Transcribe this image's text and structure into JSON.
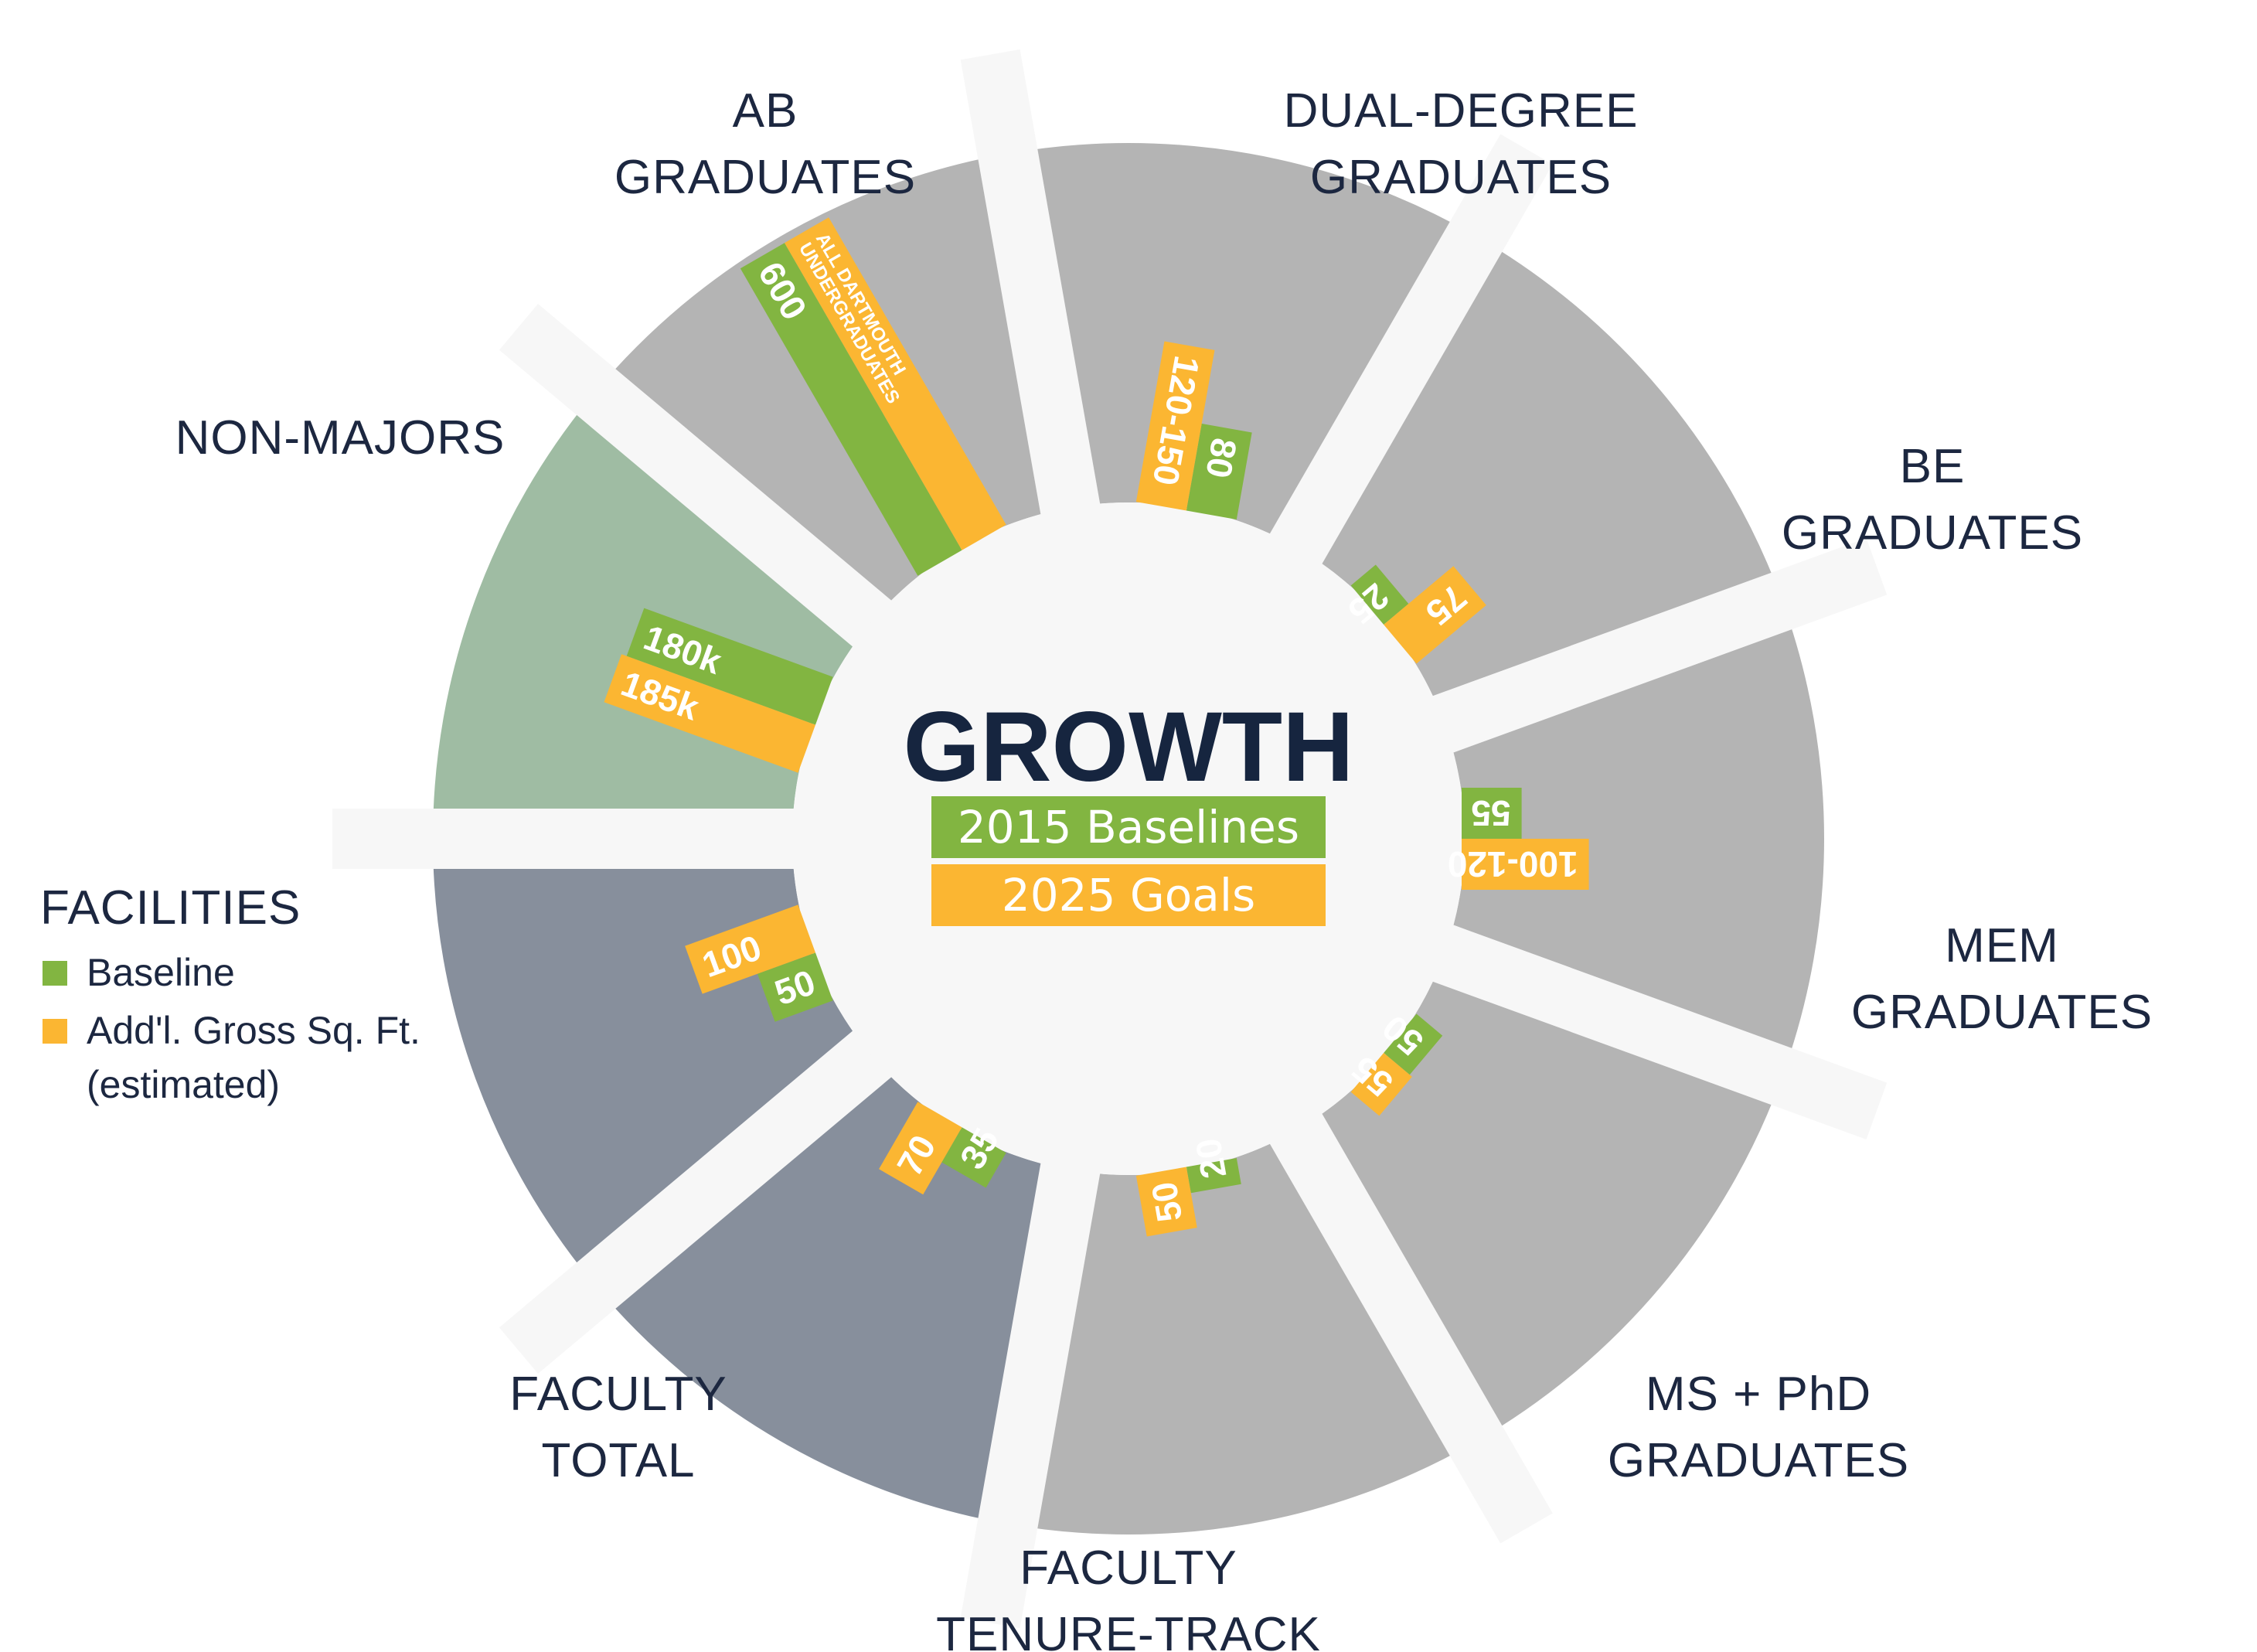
{
  "colors": {
    "baseline": "#82b541",
    "goal": "#fbb632",
    "sector_gray": "#b4b4b4",
    "sector_green": "#9fbca3",
    "sector_dark": "#878f9c",
    "gap": "#f7f7f7",
    "center": "#f7f7f7",
    "text": "#1c2740"
  },
  "center": {
    "title": "GROWTH",
    "key_baseline": "2015 Baselines",
    "key_goal": "2025 Goals"
  },
  "legend": {
    "heading": "FACILITIES",
    "baseline_label": "Baseline",
    "goal_label_line1": "Add'l. Gross Sq. Ft.",
    "goal_label_line2": "(estimated)"
  },
  "chart_data": {
    "type": "bar",
    "layout": "radial",
    "title": "GROWTH",
    "categories": [
      "AB GRADUATES",
      "DUAL-DEGREE GRADUATES",
      "BE GRADUATES",
      "MEM GRADUATES",
      "MS + PhD GRADUATES",
      "FACULTY TENURE-TRACK",
      "FACULTY TOTAL",
      "FACILITIES",
      "NON-MAJORS"
    ],
    "series": [
      {
        "name": "2015 Baselines",
        "values": [
          80,
          25,
          55,
          50,
          20,
          35,
          50,
          180,
          600
        ],
        "labels": [
          "80",
          "25",
          "55",
          "50",
          "20",
          "35",
          "50",
          "180k",
          "600"
        ]
      },
      {
        "name": "2025 Goals",
        "values": [
          150,
          75,
          120,
          55,
          50,
          70,
          100,
          185,
          null
        ],
        "labels": [
          "120-150",
          "75",
          "100-120",
          "55",
          "50",
          "70",
          "100",
          "185k",
          [
            "ALL DARTMOUTH",
            "UNDERGRADUATES"
          ]
        ]
      }
    ]
  },
  "sectors": [
    {
      "label_lines": [
        "AB",
        "GRADUATES"
      ]
    },
    {
      "label_lines": [
        "DUAL-DEGREE",
        "GRADUATES"
      ]
    },
    {
      "label_lines": [
        "BE",
        "GRADUATES"
      ]
    },
    {
      "label_lines": [
        "MEM",
        "GRADUATES"
      ]
    },
    {
      "label_lines": [
        "MS + PhD",
        "GRADUATES"
      ]
    },
    {
      "label_lines": [
        "FACULTY",
        "TENURE-TRACK"
      ]
    },
    {
      "label_lines": [
        "FACULTY",
        "TOTAL"
      ]
    },
    {
      "label_lines": []
    },
    {
      "label_lines": [
        "NON-MAJORS"
      ]
    }
  ]
}
